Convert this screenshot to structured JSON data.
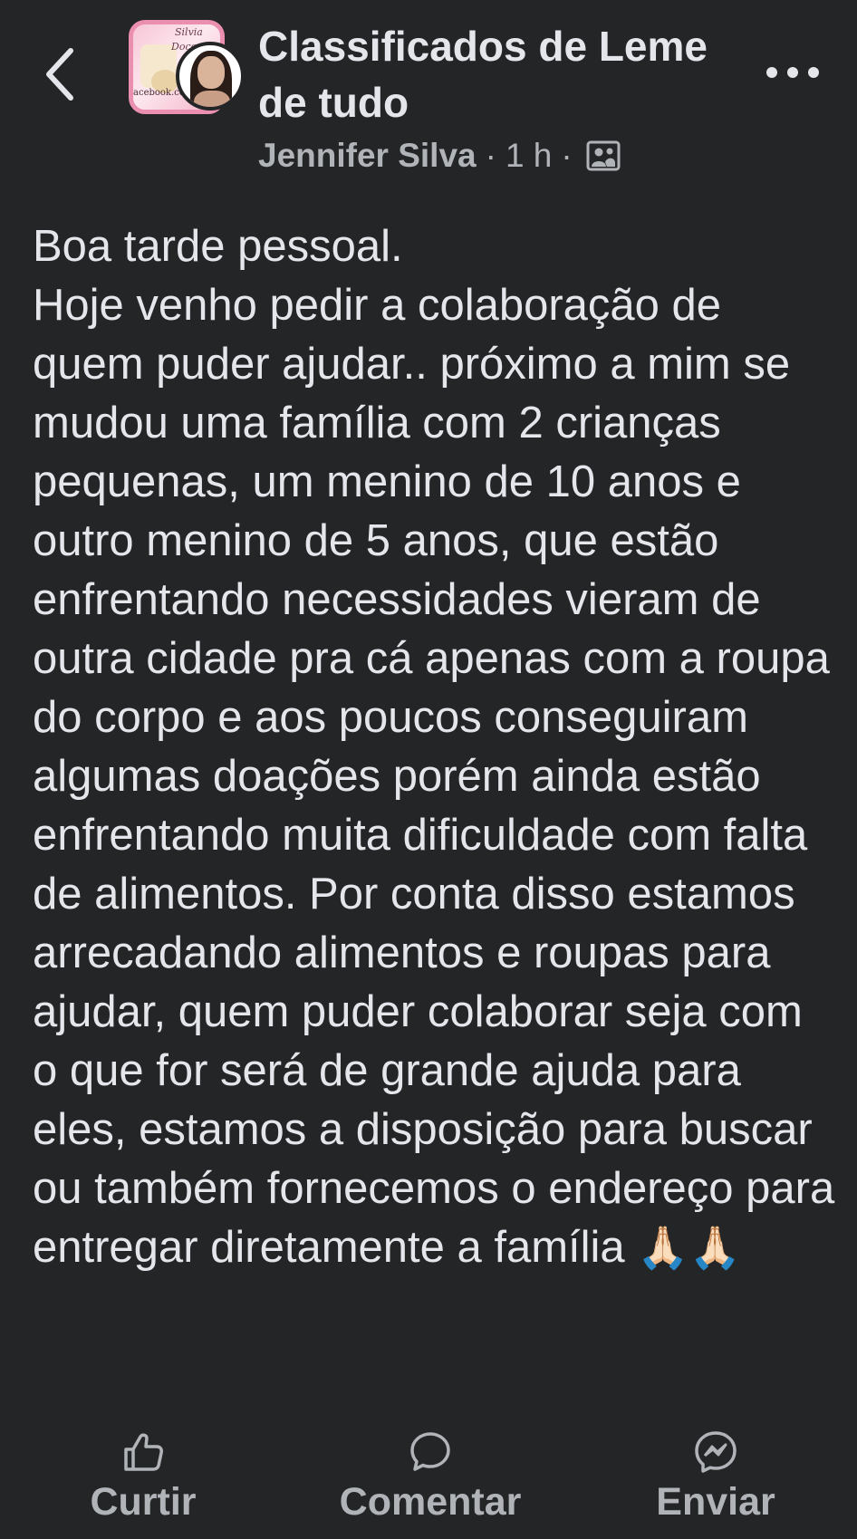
{
  "header": {
    "back_icon": "chevron-left-icon",
    "group_name": "Classificados de Leme de tudo",
    "author": "Jennifer Silva",
    "time": "1 h",
    "separator": "·",
    "audience_icon": "members-icon",
    "more_icon": "more-horizontal-icon",
    "group_avatar_text": [
      "Silvia",
      "Doces",
      "acebook.com"
    ]
  },
  "post": {
    "lines": [
      "Boa tarde pessoal.",
      "Hoje venho pedir a colaboração de quem puder ajudar.. próximo a mim se mudou uma família com 2 crianças pequenas, um menino de 10 anos e outro menino de 5 anos, que estão enfrentando necessidades vieram de outra cidade pra cá apenas com a roupa do corpo e aos poucos conseguiram algumas doações porém ainda estão enfrentando muita dificuldade com falta de alimentos. Por conta disso estamos arrecadando alimentos e roupas para ajudar, quem puder colaborar seja com o que for será de grande ajuda para eles, estamos a disposição para buscar ou também fornecemos o endereço para entregar diretamente a família"
    ],
    "emoji": "🙏🏻🙏🏻"
  },
  "actions": {
    "like": {
      "label": "Curtir",
      "icon": "thumbs-up-icon"
    },
    "comment": {
      "label": "Comentar",
      "icon": "comment-icon"
    },
    "send": {
      "label": "Enviar",
      "icon": "messenger-icon"
    }
  },
  "colors": {
    "background": "#242526",
    "text_primary": "#e4e6eb",
    "text_secondary": "#b0b3b8"
  }
}
